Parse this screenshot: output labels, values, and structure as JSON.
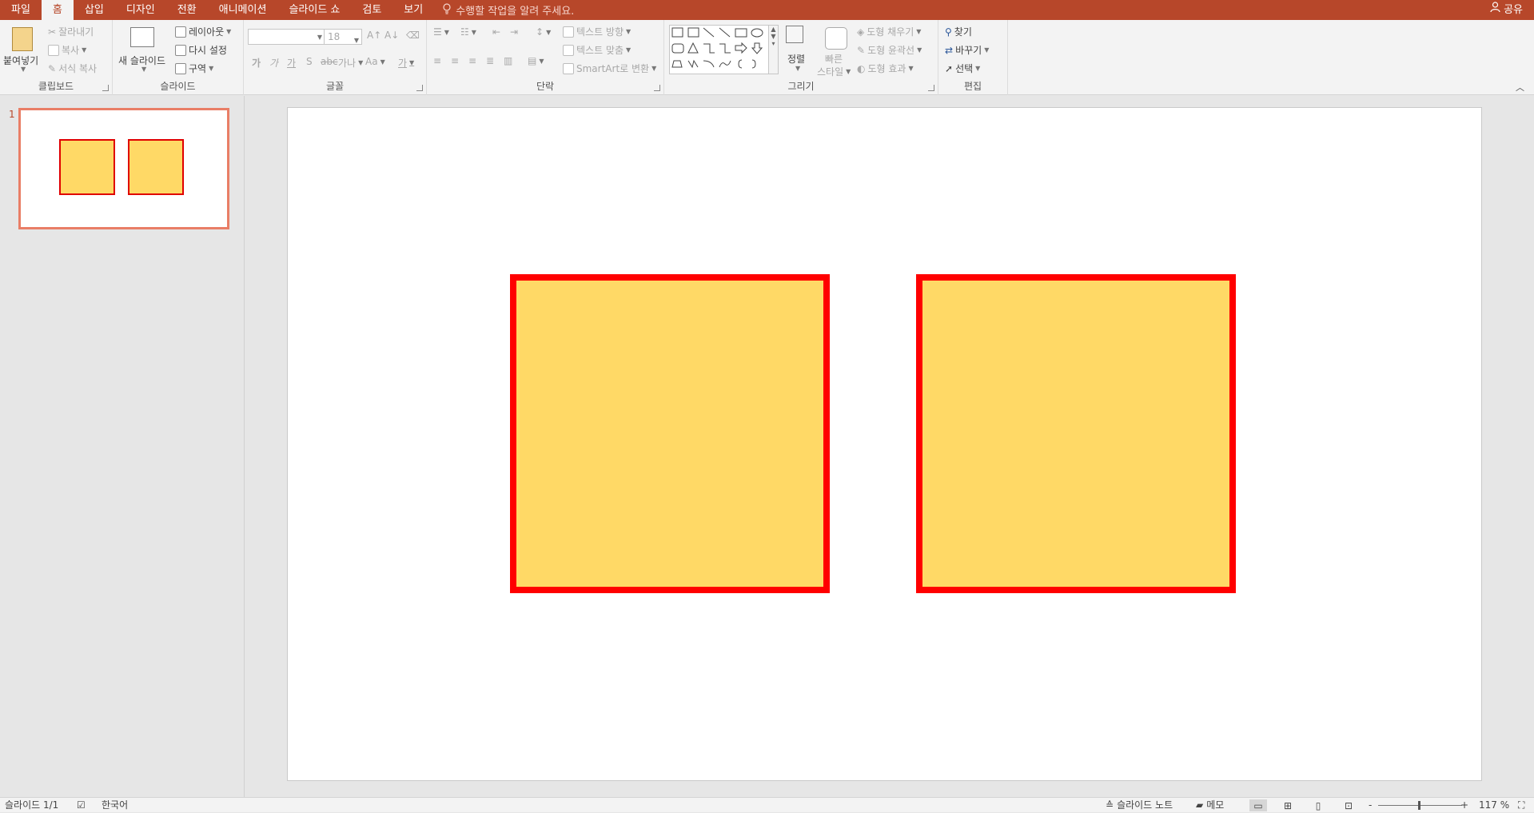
{
  "tabs": [
    "파일",
    "홈",
    "삽입",
    "디자인",
    "전환",
    "애니메이션",
    "슬라이드 쇼",
    "검토",
    "보기"
  ],
  "active_tab_index": 1,
  "tell_me": "수행할 작업을 알려 주세요.",
  "share_label": "공유",
  "ribbon": {
    "clipboard": {
      "paste": "붙여넣기",
      "cut": "잘라내기",
      "copy": "복사",
      "format_painter": "서식 복사",
      "label": "클립보드"
    },
    "slides": {
      "new_slide": "새 슬라이드",
      "layout": "레이아웃",
      "reset": "다시 설정",
      "section": "구역",
      "label": "슬라이드"
    },
    "font": {
      "font_name": "",
      "font_size": "18",
      "label": "글꼴",
      "bold": "가",
      "italic": "가",
      "underline": "가",
      "shadow": "S",
      "strike": "abc",
      "spacing": "가나",
      "case": "Aa",
      "color": "가"
    },
    "paragraph": {
      "text_direction": "텍스트 방향",
      "align_text": "텍스트 맞춤",
      "smartart": "SmartArt로 변환",
      "label": "단락"
    },
    "drawing": {
      "arrange": "정렬",
      "quick_styles_1": "빠른",
      "quick_styles_2": "스타일",
      "shape_fill": "도형 채우기",
      "shape_outline": "도형 윤곽선",
      "shape_effects": "도형 효과",
      "label": "그리기"
    },
    "editing": {
      "find": "찾기",
      "replace": "바꾸기",
      "select": "선택",
      "label": "편집"
    }
  },
  "thumbnails": [
    {
      "number": "1"
    }
  ],
  "slide": {
    "shapes": [
      {
        "name": "left-square",
        "fill": "#ffd966",
        "outline": "#ff0000"
      },
      {
        "name": "right-square",
        "fill": "#ffd966",
        "outline": "#ff0000"
      }
    ]
  },
  "status": {
    "slide_info": "슬라이드 1/1",
    "language": "한국어",
    "notes": "슬라이드 노트",
    "comments": "메모",
    "zoom_minus": "-",
    "zoom_plus": "+",
    "zoom_level": "117 %"
  },
  "colors": {
    "accent": "#b7472a",
    "shape_fill": "#ffd966",
    "shape_outline": "#ff0000"
  }
}
